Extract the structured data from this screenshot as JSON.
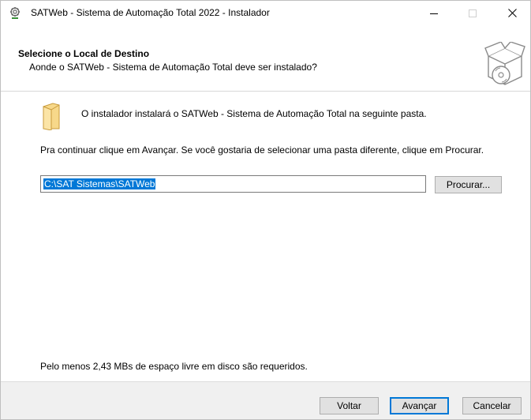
{
  "window": {
    "title": "SATWeb - Sistema de Automação Total 2022 - Instalador"
  },
  "header": {
    "title": "Selecione o Local de Destino",
    "subtitle": "Aonde o SATWeb - Sistema de Automação Total deve ser instalado?",
    "icon": "install-box-icon"
  },
  "content": {
    "install_message": "O instalador instalará o SATWeb - Sistema de Automação Total na seguinte pasta.",
    "continue_message": "Pra continuar clique em Avançar. Se você gostaria de selecionar uma pasta diferente, clique em Procurar.",
    "path_value": "C:\\SAT Sistemas\\SATWeb",
    "browse_label": "Procurar...",
    "space_message": "Pelo menos 2,43 MBs de espaço livre em disco são requeridos."
  },
  "footer": {
    "back_label": "Voltar",
    "next_label": "Avançar",
    "cancel_label": "Cancelar"
  },
  "colors": {
    "selection": "#0078d7",
    "footer_bg": "#f0f0f0",
    "button_bg": "#e1e1e1",
    "folder": "#f7d88a"
  }
}
